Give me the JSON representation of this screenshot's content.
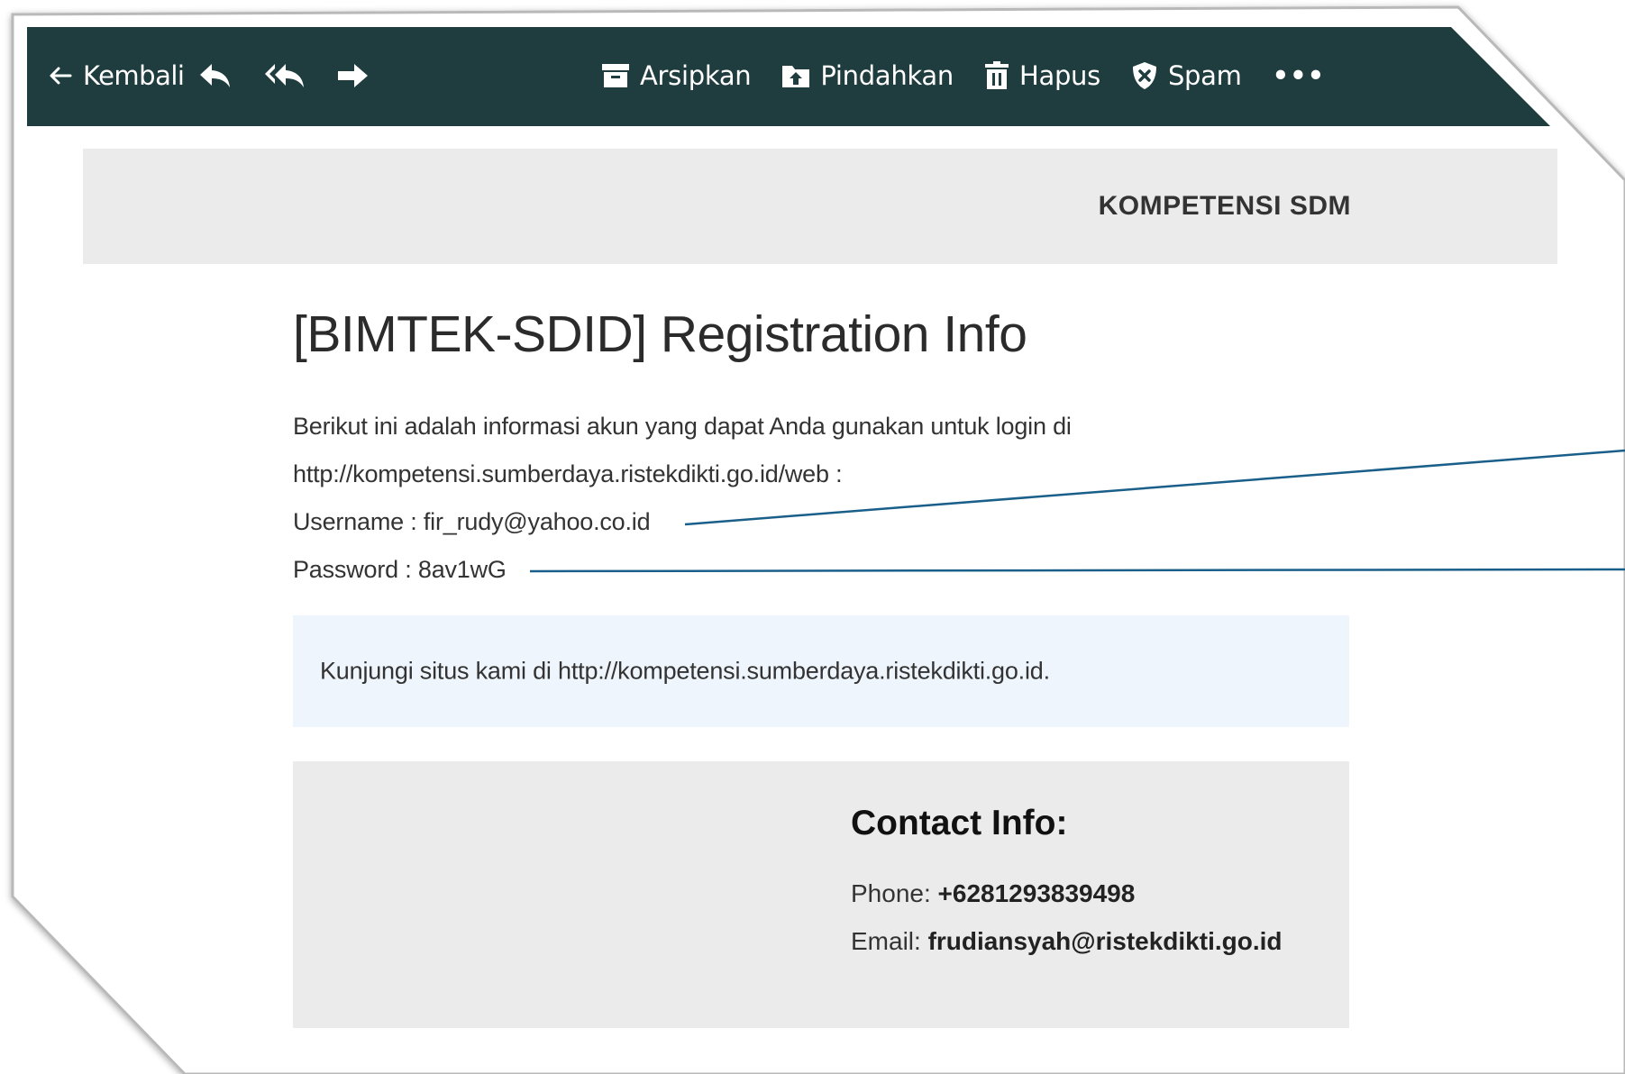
{
  "colors": {
    "toolbar_bg": "#1f3d3f",
    "band_bg": "#ebebeb",
    "note_bg": "#eef5fc",
    "callout_line": "#1a5f8a"
  },
  "toolbar": {
    "back_label": "Kembali",
    "reply_icon": "reply-icon",
    "reply_all_icon": "reply-all-icon",
    "forward_icon": "forward-icon",
    "archive_label": "Arsipkan",
    "move_label": "Pindahkan",
    "delete_label": "Hapus",
    "spam_label": "Spam",
    "more_label": "•••"
  },
  "email": {
    "brand": "KOMPETENSI SDM",
    "title": "[BIMTEK-SDID] Registration Info",
    "intro_line1": "Berikut ini adalah informasi akun yang dapat Anda gunakan untuk login di",
    "intro_line2": "http://kompetensi.sumberdaya.ristekdikti.go.id/web :",
    "username_label": "Username :",
    "username_value": "fir_rudy@yahoo.co.id",
    "password_label": "Password :",
    "password_value": "8av1wG",
    "visit_text": "Kunjungi situs kami di http://kompetensi.sumberdaya.ristekdikti.go.id.",
    "contact": {
      "title": "Contact Info:",
      "phone_label": "Phone:",
      "phone_value": "+6281293839498",
      "email_label": "Email:",
      "email_value": "frudiansyah@ristekdikti.go.id"
    }
  }
}
